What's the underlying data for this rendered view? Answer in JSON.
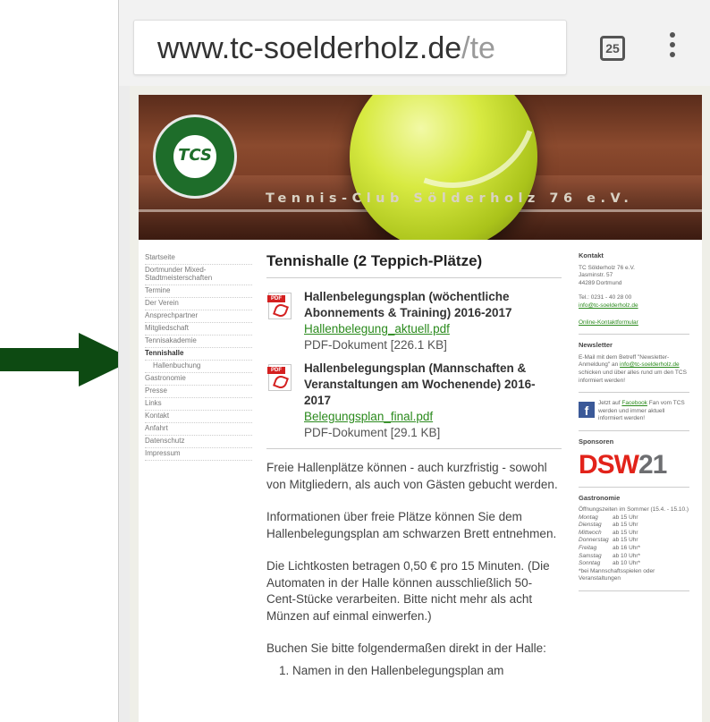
{
  "browser": {
    "url_main": "www.tc-soelderholz.de",
    "url_dim": "/te",
    "tab_count": "25"
  },
  "colors": {
    "arrow": "#0d4a12",
    "link": "#2b8a1d",
    "sponsor_red": "#e2231a"
  },
  "header": {
    "logo_text": "TCS",
    "title": "Tennis-Club Sölderholz 76 e.V."
  },
  "nav": {
    "items": [
      "Startseite",
      "Dortmunder Mixed-Stadtmeisterschaften",
      "Termine",
      "Der Verein",
      "Ansprechpartner",
      "Mitgliedschaft",
      "Tennisakademie",
      "Tennishalle",
      "Hallenbuchung",
      "Gastronomie",
      "Presse",
      "Links",
      "Kontakt",
      "Anfahrt",
      "Datenschutz",
      "Impressum"
    ]
  },
  "main": {
    "heading": "Tennishalle (2 Teppich-Plätze)",
    "doc1": {
      "title": "Hallenbelegungsplan (wöchentliche Abonnements & Training) 2016-2017",
      "link": "Hallenbelegung_aktuell.pdf",
      "meta": "PDF-Dokument [226.1 KB]"
    },
    "doc2": {
      "title": "Hallenbelegungsplan (Mannschaften & Veranstaltungen am Wochenende) 2016-2017",
      "link": "Belegungsplan_final.pdf",
      "meta": "PDF-Dokument [29.1 KB]"
    },
    "p1": "Freie Hallenplätze können - auch kurzfristig - sowohl von Mitgliedern, als auch von Gästen gebucht werden.",
    "p2": "Informationen über freie Plätze können Sie dem Hallenbelegungsplan am schwarzen Brett entnehmen.",
    "p3": "Die Lichtkosten betragen 0,50 € pro 15 Minuten. (Die Automaten in der Halle können ausschließlich 50-Cent-Stücke verarbeiten. Bitte nicht mehr als acht Münzen auf einmal einwerfen.)",
    "p4": "Buchen Sie bitte folgendermaßen direkt in der Halle:",
    "p5": "1. Namen in den Hallenbelegungsplan am"
  },
  "sidebar": {
    "contact_heading": "Kontakt",
    "address1": "TC Sölderholz 76 e.V.",
    "address2": "Jasminstr. 57",
    "address3": "44289 Dortmund",
    "tel": "Tel.: 0231 - 40 28 00",
    "email": "info@tc-soelderholz.de",
    "contact_form": "Online-Kontaktformular",
    "newsletter_heading": "Newsletter",
    "newsletter_text1": "E-Mail mit dem Betreff \"Newsletter-Anmeldung\" an",
    "newsletter_email": "info@tc-soelderholz.de",
    "newsletter_text2": "schicken und über alles rund um den TCS informiert werden!",
    "fb_text1": "Jetzt auf",
    "fb_link": "Facebook",
    "fb_text2": "Fan vom TCS werden und immer aktuell informiert werden!",
    "sponsors_heading": "Sponsoren",
    "sponsor_logo": "DSW",
    "sponsor_logo_suffix": "21",
    "gastro_heading": "Gastronomie",
    "gastro_intro": "Öffnungszeiten im Sommer (15.4. - 15.10.)",
    "hours": [
      {
        "day": "Montag",
        "time": "ab 15 Uhr"
      },
      {
        "day": "Dienstag",
        "time": "ab 15 Uhr"
      },
      {
        "day": "Mittwoch",
        "time": "ab 15 Uhr"
      },
      {
        "day": "Donnerstag",
        "time": "ab 15 Uhr"
      },
      {
        "day": "Freitag",
        "time": "ab 16 Uhr*"
      },
      {
        "day": "Samstag",
        "time": "ab 10 Uhr*"
      },
      {
        "day": "Sonntag",
        "time": "ab 10 Uhr*"
      }
    ],
    "gastro_note": "*bei Mannschaftsspielen oder Veranstaltungen"
  }
}
